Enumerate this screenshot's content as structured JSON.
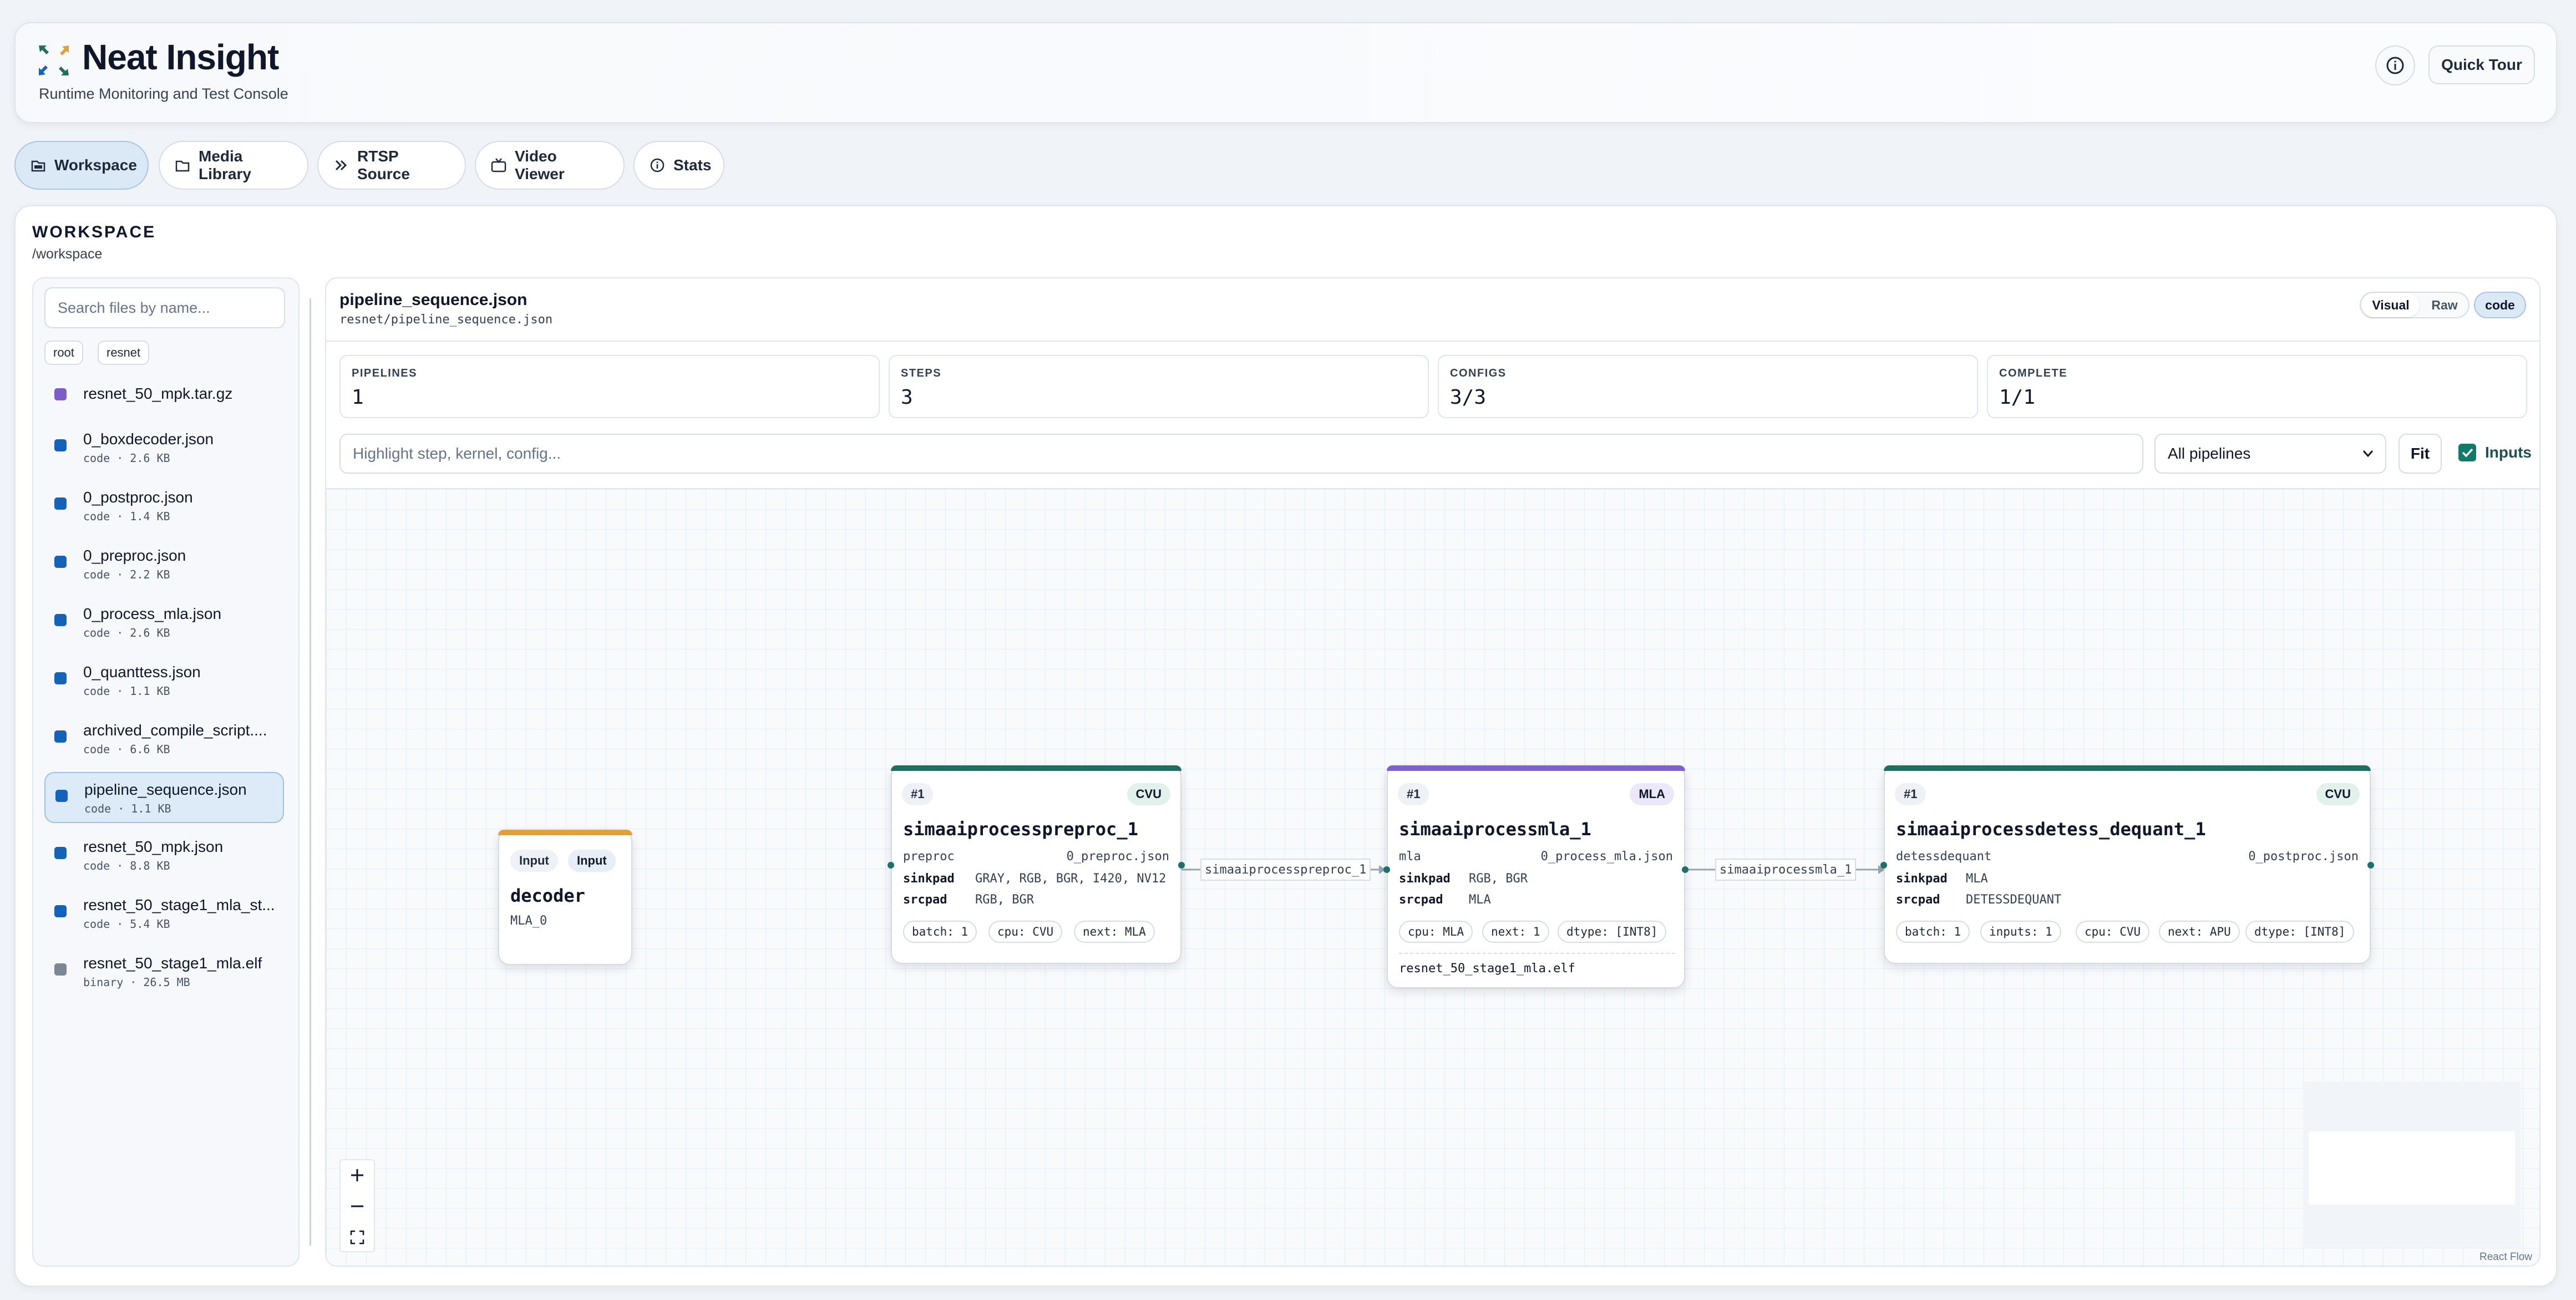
{
  "app": {
    "title": "Neat Insight",
    "subtitle": "Runtime Monitoring and Test Console",
    "tour_label": "Quick Tour"
  },
  "nav": {
    "tabs": [
      {
        "label": "Workspace",
        "icon": "workspace-icon",
        "active": true
      },
      {
        "label": "Media Library",
        "icon": "folder-icon"
      },
      {
        "label": "RTSP Source",
        "icon": "double-chevron-icon"
      },
      {
        "label": "Video Viewer",
        "icon": "tv-icon"
      },
      {
        "label": "Stats",
        "icon": "info-icon"
      }
    ]
  },
  "workspace": {
    "title": "WORKSPACE",
    "path": "/workspace"
  },
  "sidebar": {
    "search_placeholder": "Search files by name...",
    "crumbs": [
      "root",
      "resnet"
    ],
    "files": [
      {
        "name": "resnet_50_mpk.tar.gz",
        "meta": "",
        "color": "#7c5cc9",
        "selected": false
      },
      {
        "name": "0_boxdecoder.json",
        "meta": "code · 2.6 KB",
        "color": "#1463b8",
        "selected": false
      },
      {
        "name": "0_postproc.json",
        "meta": "code · 1.4 KB",
        "color": "#1463b8",
        "selected": false
      },
      {
        "name": "0_preproc.json",
        "meta": "code · 2.2 KB",
        "color": "#1463b8",
        "selected": false
      },
      {
        "name": "0_process_mla.json",
        "meta": "code · 2.6 KB",
        "color": "#1463b8",
        "selected": false
      },
      {
        "name": "0_quanttess.json",
        "meta": "code · 1.1 KB",
        "color": "#1463b8",
        "selected": false
      },
      {
        "name": "archived_compile_script....",
        "meta": "code · 6.6 KB",
        "color": "#1463b8",
        "selected": false
      },
      {
        "name": "pipeline_sequence.json",
        "meta": "code · 1.1 KB",
        "color": "#1463b8",
        "selected": true
      },
      {
        "name": "resnet_50_mpk.json",
        "meta": "code · 8.8 KB",
        "color": "#1463b8",
        "selected": false
      },
      {
        "name": "resnet_50_stage1_mla_st...",
        "meta": "code · 5.4 KB",
        "color": "#1463b8",
        "selected": false
      },
      {
        "name": "resnet_50_stage1_mla.elf",
        "meta": "binary · 26.5 MB",
        "color": "#7b8794",
        "selected": false
      }
    ]
  },
  "editor": {
    "file_title": "pipeline_sequence.json",
    "file_path": "resnet/pipeline_sequence.json",
    "view_visual": "Visual",
    "view_raw": "Raw",
    "badge": "code",
    "stats": [
      {
        "label": "PIPELINES",
        "value": "1"
      },
      {
        "label": "STEPS",
        "value": "3"
      },
      {
        "label": "CONFIGS",
        "value": "3/3"
      },
      {
        "label": "COMPLETE",
        "value": "1/1"
      }
    ],
    "highlight_placeholder": "Highlight step, kernel, config...",
    "pipeline_select": "All pipelines",
    "fit_label": "Fit",
    "inputs_label": "Inputs",
    "inputs_checked": true
  },
  "graph": {
    "input_node": {
      "pill1": "Input",
      "pill2": "Input",
      "title": "decoder",
      "sub": "MLA_0",
      "color": "#e0a13a"
    },
    "nodes": [
      {
        "index": "#1",
        "kind": "CVU",
        "color": "#1f6f5f",
        "title": "simaaiprocesspreproc_1",
        "name": "preproc",
        "config": "0_preproc.json",
        "sinkpad": "GRAY, RGB, BGR, I420, NV12",
        "srcpad": "RGB, BGR",
        "tags": [
          "batch: 1",
          "cpu: CVU",
          "next: MLA"
        ],
        "footer": ""
      },
      {
        "index": "#1",
        "kind": "MLA",
        "color": "#7b61d1",
        "title": "simaaiprocessmla_1",
        "name": "mla",
        "config": "0_process_mla.json",
        "sinkpad": "RGB, BGR",
        "srcpad": "MLA",
        "tags": [
          "cpu: MLA",
          "next: 1",
          "dtype: [INT8]"
        ],
        "footer": "resnet_50_stage1_mla.elf"
      },
      {
        "index": "#1",
        "kind": "CVU",
        "color": "#1f6f5f",
        "title": "simaaiprocessdetess_dequant_1",
        "name": "detessdequant",
        "config": "0_postproc.json",
        "sinkpad": "MLA",
        "srcpad": "DETESSDEQUANT",
        "tags": [
          "batch: 1",
          "inputs: 1",
          "cpu: CVU",
          "next: APU",
          "dtype: [INT8]"
        ],
        "footer": ""
      }
    ],
    "edges": [
      "simaaiprocesspreproc_1",
      "simaaiprocessmla_1"
    ],
    "sinkpad_key": "sinkpad",
    "srcpad_key": "srcpad",
    "attribution": "React Flow"
  }
}
